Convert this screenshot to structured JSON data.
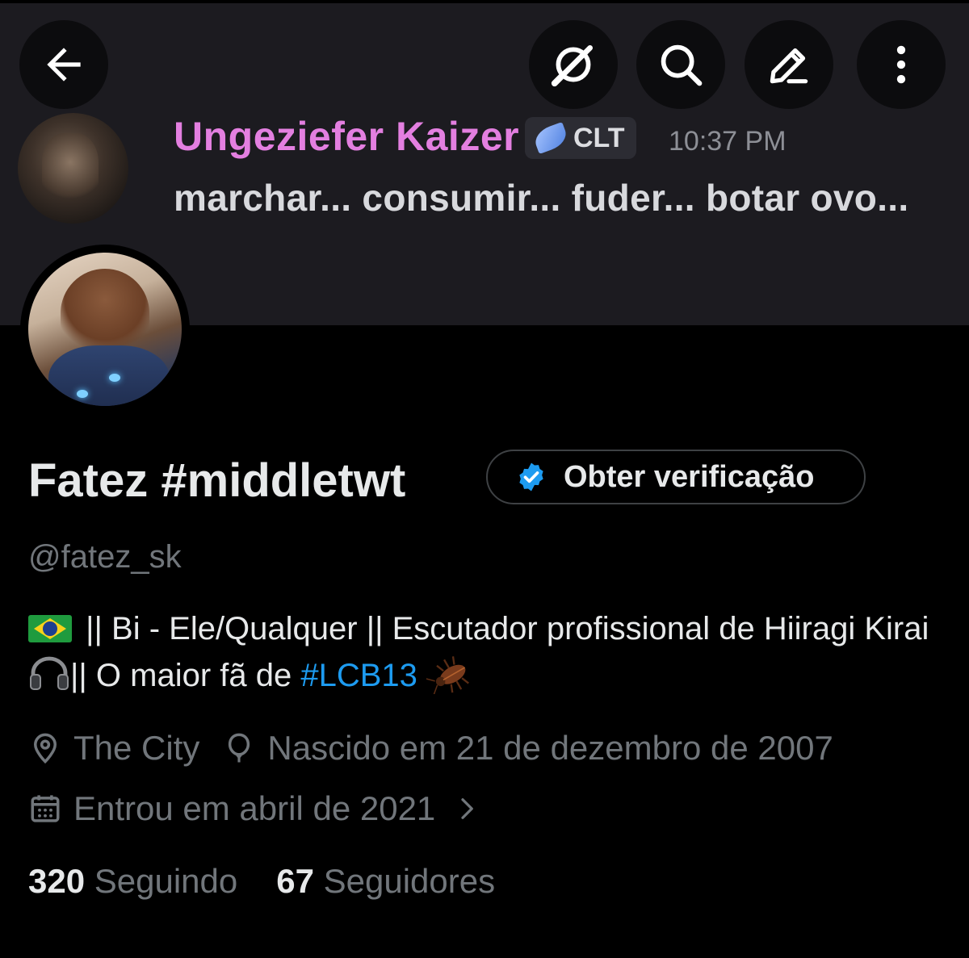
{
  "banner": {
    "message": {
      "author": "Ungeziefer Kaizer",
      "tag": "CLT",
      "time": "10:37 PM",
      "text": "marchar... consumir... fuder... botar ovo..."
    }
  },
  "nav": {
    "icons": [
      "back-arrow-icon",
      "grok-icon",
      "search-icon",
      "edit-icon",
      "more-vertical-icon"
    ]
  },
  "profile": {
    "display_name": "Fatez #middletwt",
    "verify_label": "Obter verificação",
    "handle": "@fatez_sk",
    "bio": {
      "part1": "|| Bi - Ele/Qualquer || Escutador profissional de Hiiragi Kirai",
      "part2": "|| O maior fã de",
      "hashtag": "#LCB13"
    },
    "location": "The City",
    "birth": "Nascido em 21 de dezembro de 2007",
    "joined": "Entrou em abril de 2021",
    "following_count": "320",
    "following_label": "Seguindo",
    "followers_count": "67",
    "followers_label": "Seguidores"
  },
  "colors": {
    "background": "#000000",
    "banner": "#1c1b20",
    "text_primary": "#e7e9ea",
    "text_secondary": "#71767b",
    "accent": "#1d9bf0",
    "author_name": "#e37fe0"
  }
}
